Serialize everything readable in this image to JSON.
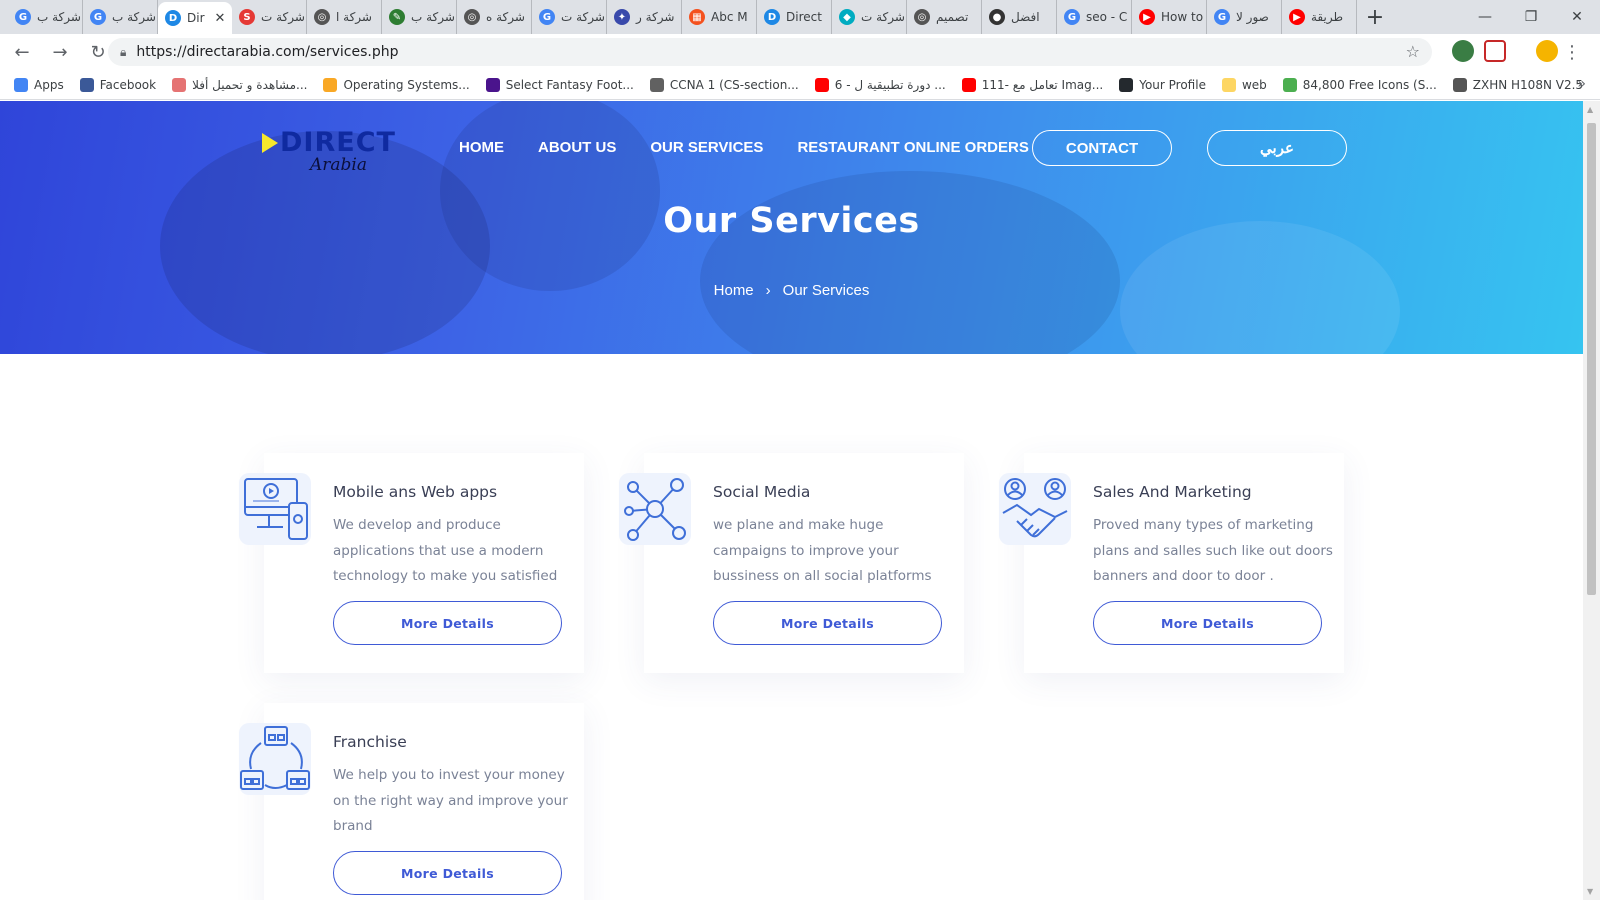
{
  "browser": {
    "tabs": [
      {
        "label": "شركة ب",
        "color": "#4285f4",
        "glyph": "G"
      },
      {
        "label": "شركة ب",
        "color": "#4285f4",
        "glyph": "G"
      },
      {
        "label": "Dir",
        "color": "#1e88e5",
        "glyph": "D",
        "active": true
      },
      {
        "label": "شركة ت",
        "color": "#e53935",
        "glyph": "S"
      },
      {
        "label": "شركة ا",
        "color": "#555555",
        "glyph": "◎"
      },
      {
        "label": "شركة ب",
        "color": "#2e7d32",
        "glyph": "✎"
      },
      {
        "label": "شركة ه",
        "color": "#555555",
        "glyph": "◎"
      },
      {
        "label": "شركة ت",
        "color": "#4285f4",
        "glyph": "G"
      },
      {
        "label": "شركة ر",
        "color": "#3949ab",
        "glyph": "✦"
      },
      {
        "label": "Abc M",
        "color": "#f4511e",
        "glyph": "▦"
      },
      {
        "label": "Direct",
        "color": "#1e88e5",
        "glyph": "D"
      },
      {
        "label": "شركة ت",
        "color": "#00acc1",
        "glyph": "◆"
      },
      {
        "label": "تصميم",
        "color": "#555555",
        "glyph": "◎"
      },
      {
        "label": "افضل",
        "color": "#333333",
        "glyph": "●"
      },
      {
        "label": "seo - C",
        "color": "#4285f4",
        "glyph": "G"
      },
      {
        "label": "How to",
        "color": "#ff0000",
        "glyph": "▶"
      },
      {
        "label": "صور لا",
        "color": "#4285f4",
        "glyph": "G"
      },
      {
        "label": "طريقة",
        "color": "#ff0000",
        "glyph": "▶"
      }
    ],
    "new_tab": "+",
    "url": "https://directarabia.com/services.php",
    "bookmarks": [
      {
        "label": "Apps",
        "color": "#4285f4"
      },
      {
        "label": "Facebook",
        "color": "#3b5998"
      },
      {
        "label": "مشاهدة و تحميل أفلا...",
        "color": "#e57373"
      },
      {
        "label": "Operating Systems...",
        "color": "#f9a825"
      },
      {
        "label": "Select Fantasy Foot...",
        "color": "#4a148c"
      },
      {
        "label": "CCNA 1 (CS-section...",
        "color": "#616161"
      },
      {
        "label": "6 - دورة تطبيقية ل ...",
        "color": "#ff0000"
      },
      {
        "label": "111- تعامل مع Imag...",
        "color": "#ff0000"
      },
      {
        "label": "Your Profile",
        "color": "#24292e"
      },
      {
        "label": "web",
        "color": "#fdd663"
      },
      {
        "label": "84,800 Free Icons (S...",
        "color": "#4caf50"
      },
      {
        "label": "ZXHN H108N V2.5",
        "color": "#555555"
      }
    ],
    "more_bookmarks": "»"
  },
  "header": {
    "logo_word": "DIRECT",
    "logo_sub": "Arabia",
    "nav": [
      "HOME",
      "ABOUT US",
      "OUR SERVICES",
      "RESTAURANT ONLINE ORDERS"
    ],
    "contact_label": "CONTACT",
    "lang_label": "عربي"
  },
  "hero": {
    "title": "Our Services",
    "breadcrumb_home": "Home",
    "breadcrumb_sep": "›",
    "breadcrumb_current": "Our Services"
  },
  "services": [
    {
      "title": "Mobile ans Web apps",
      "description": "We develop and produce applications that use a modern technology to make you satisfied",
      "button": "More Details",
      "icon": "devices-icon"
    },
    {
      "title": "Social Media",
      "description": "we plane and make huge campaigns to improve your bussiness on all social platforms",
      "button": "More Details",
      "icon": "network-icon"
    },
    {
      "title": "Sales And Marketing",
      "description": "Proved many types of marketing plans and salles such like out doors banners and door to door .",
      "button": "More Details",
      "icon": "handshake-icon"
    },
    {
      "title": "Franchise",
      "description": "We help you to invest your money on the right way and improve your brand",
      "button": "More Details",
      "icon": "stores-icon"
    }
  ],
  "colors": {
    "accent": "#3f5ad6",
    "hero_start": "#2f45d9",
    "hero_end": "#36c4f0"
  }
}
